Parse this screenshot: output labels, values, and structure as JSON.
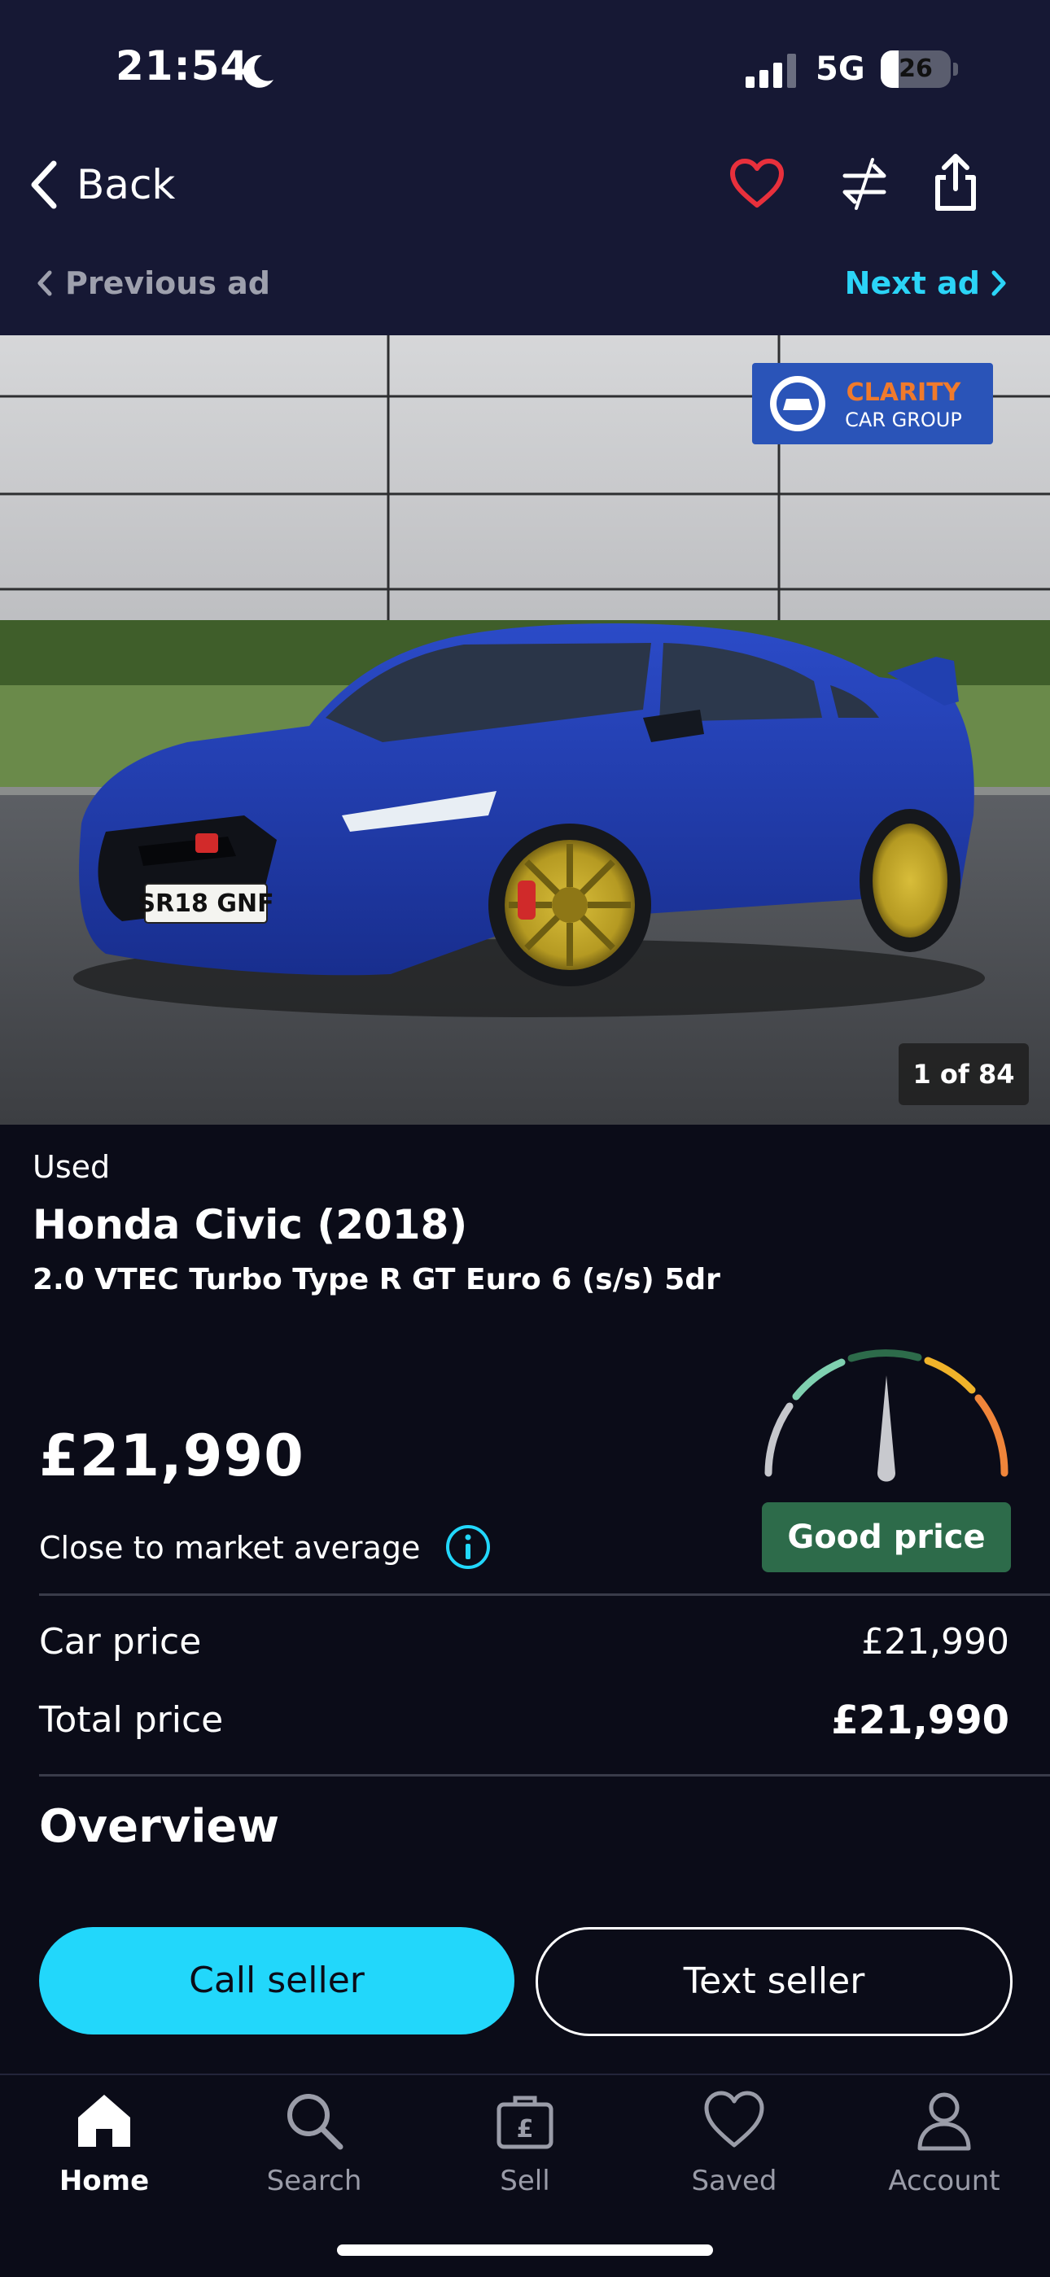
{
  "status_bar": {
    "time": "21:54",
    "network": "5G",
    "battery": "26",
    "battery_level": 0.26
  },
  "header": {
    "back_label": "Back",
    "previous_ad": "Previous ad",
    "next_ad": "Next ad"
  },
  "photo": {
    "dealer_logo_line1": "CLARITY",
    "dealer_logo_line2": "CAR GROUP",
    "plate": "SR18 GNF",
    "counter": "1 of 84"
  },
  "listing": {
    "condition": "Used",
    "title": "Honda Civic (2018)",
    "subtitle": "2.0 VTEC Turbo Type R GT Euro 6 (s/s) 5dr",
    "price": "£21,990",
    "market_text": "Close to market average",
    "rating": "Good price",
    "car_price_label": "Car price",
    "car_price_value": "£21,990",
    "total_price_label": "Total price",
    "total_price_value": "£21,990",
    "overview_heading": "Overview"
  },
  "actions": {
    "call": "Call seller",
    "text": "Text seller"
  },
  "nav": [
    {
      "label": "Home",
      "icon": "home-icon"
    },
    {
      "label": "Search",
      "icon": "search-icon"
    },
    {
      "label": "Sell",
      "icon": "sell-pound-icon"
    },
    {
      "label": "Saved",
      "icon": "heart-icon"
    },
    {
      "label": "Account",
      "icon": "person-icon"
    }
  ],
  "colors": {
    "accent": "#22d7fb",
    "favorite": "#e8303c",
    "good_price": "#2d6b4a",
    "header_bg": "#161834",
    "page_bg": "#0b0c18"
  }
}
